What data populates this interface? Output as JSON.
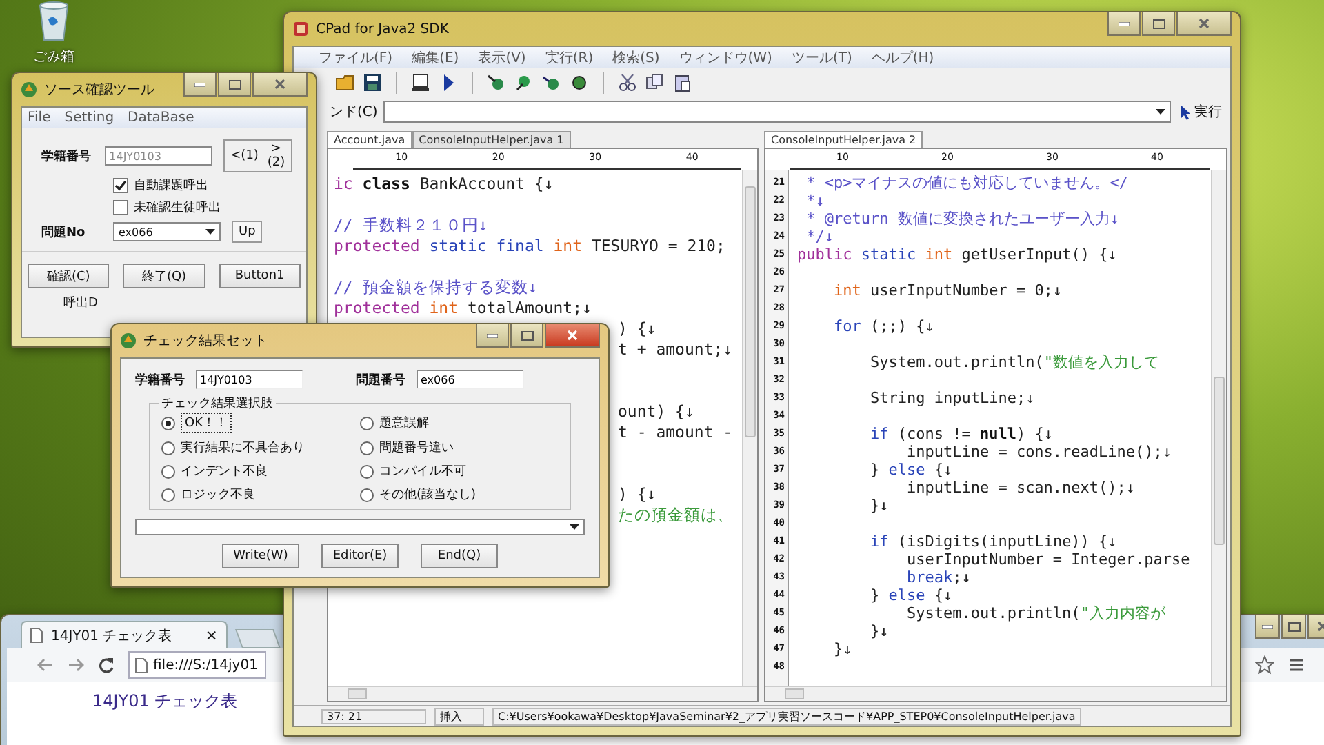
{
  "desktop": {
    "icons": [
      {
        "label": "ごみ箱"
      }
    ]
  },
  "source_tool": {
    "title": "ソース確認ツール",
    "menu": [
      "File",
      "Setting",
      "DataBase"
    ],
    "student_label": "学籍番号",
    "student_id": "14JY0103",
    "nav_buttons": [
      "<(1)",
      ">(2)"
    ],
    "checkboxes": [
      {
        "label": "自動課題呼出",
        "checked": true
      },
      {
        "label": "未確認生徒呼出",
        "checked": false
      }
    ],
    "problem_label": "問題No",
    "problem_value": "ex066",
    "up_button": "Up",
    "buttons": [
      "確認(C)",
      "終了(Q)",
      "Button1"
    ],
    "call_label": "呼出D"
  },
  "editor_window": {
    "title": "CPad for Java2 SDK",
    "menu": [
      "ファイル(F)",
      "編集(E)",
      "表示(V)",
      "実行(R)",
      "検索(S)",
      "ウィンドウ(W)",
      "ツール(T)",
      "ヘルプ(H)"
    ],
    "command_label": "ンド(C)",
    "run_button": "実行",
    "panes": [
      {
        "tabs": [
          {
            "label": "Account.java",
            "selected": true
          },
          {
            "label": "ConsoleInputHelper.java 1",
            "selected": false
          }
        ],
        "ruler": [
          "10",
          "20",
          "30",
          "40"
        ],
        "lines": [
          {
            "kind": "code",
            "tokens": [
              {
                "kind": "keyword",
                "text": "ic "
              },
              {
                "kind": "bold",
                "text": "class"
              },
              {
                "kind": "plain",
                "text": " BankAccount {↓"
              }
            ]
          },
          {
            "kind": "blank"
          },
          {
            "kind": "code",
            "tokens": [
              {
                "kind": "comment",
                "text": "// 手数料２１０円↓"
              }
            ]
          },
          {
            "kind": "code",
            "tokens": [
              {
                "kind": "keyword",
                "text": "protected"
              },
              {
                "kind": "modifier",
                "text": " static final"
              },
              {
                "kind": "type",
                "text": " int"
              },
              {
                "kind": "plain",
                "text": " TESURYO = 210;"
              }
            ]
          },
          {
            "kind": "blank"
          },
          {
            "kind": "code",
            "tokens": [
              {
                "kind": "comment",
                "text": "// 預金額を保持する変数↓"
              }
            ]
          },
          {
            "kind": "code",
            "tokens": [
              {
                "kind": "keyword",
                "text": "protected"
              },
              {
                "kind": "type",
                "text": " int"
              },
              {
                "kind": "plain",
                "text": " totalAmount;↓"
              }
            ]
          },
          {
            "kind": "tail",
            "tokens": [
              {
                "kind": "plain",
                "text": ") {↓"
              }
            ]
          },
          {
            "kind": "tail",
            "tokens": [
              {
                "kind": "plain",
                "text": "t + amount;↓"
              }
            ]
          },
          {
            "kind": "blank"
          },
          {
            "kind": "blank"
          },
          {
            "kind": "tail",
            "tokens": [
              {
                "kind": "plain",
                "text": "ount) {↓"
              }
            ]
          },
          {
            "kind": "tail",
            "tokens": [
              {
                "kind": "plain",
                "text": "t - amount -"
              }
            ]
          },
          {
            "kind": "blank"
          },
          {
            "kind": "blank"
          },
          {
            "kind": "tail",
            "tokens": [
              {
                "kind": "plain",
                "text": ") {↓"
              }
            ]
          },
          {
            "kind": "tail",
            "tokens": [
              {
                "kind": "string",
                "text": "たの預金額は、"
              }
            ]
          }
        ]
      },
      {
        "tabs": [
          {
            "label": "ConsoleInputHelper.java 2",
            "selected": true
          }
        ],
        "ruler": [
          "10",
          "20",
          "30",
          "40"
        ],
        "lines": [
          {
            "number": "21",
            "tokens": [
              {
                "kind": "comment",
                "text": " * <p>マイナスの値にも対応していません。</"
              }
            ]
          },
          {
            "number": "22",
            "tokens": [
              {
                "kind": "comment",
                "text": " *↓"
              }
            ]
          },
          {
            "number": "23",
            "tokens": [
              {
                "kind": "comment",
                "text": " * @return 数値に変換されたユーザー入力↓"
              }
            ]
          },
          {
            "number": "24",
            "tokens": [
              {
                "kind": "comment",
                "text": " */↓"
              }
            ]
          },
          {
            "number": "25",
            "tokens": [
              {
                "kind": "keyword",
                "text": "public"
              },
              {
                "kind": "modifier",
                "text": " static"
              },
              {
                "kind": "type",
                "text": " int"
              },
              {
                "kind": "plain",
                "text": " getUserInput() {↓"
              }
            ]
          },
          {
            "number": "26"
          },
          {
            "number": "27",
            "tokens": [
              {
                "kind": "type",
                "text": "    int"
              },
              {
                "kind": "plain",
                "text": " userInputNumber = 0;↓"
              }
            ]
          },
          {
            "number": "28"
          },
          {
            "number": "29",
            "tokens": [
              {
                "kind": "modifier",
                "text": "    for"
              },
              {
                "kind": "plain",
                "text": " (;;) {↓"
              }
            ]
          },
          {
            "number": "30"
          },
          {
            "number": "31",
            "tokens": [
              {
                "kind": "plain",
                "text": "        System.out.println("
              },
              {
                "kind": "string",
                "text": "\"数値を入力して"
              }
            ]
          },
          {
            "number": "32"
          },
          {
            "number": "33",
            "tokens": [
              {
                "kind": "plain",
                "text": "        String inputLine;↓"
              }
            ]
          },
          {
            "number": "34"
          },
          {
            "number": "35",
            "tokens": [
              {
                "kind": "modifier",
                "text": "        if"
              },
              {
                "kind": "plain",
                "text": " (cons != "
              },
              {
                "kind": "bold",
                "text": "null"
              },
              {
                "kind": "plain",
                "text": ") {↓"
              }
            ]
          },
          {
            "number": "36",
            "tokens": [
              {
                "kind": "plain",
                "text": "            inputLine = cons.readLine();↓"
              }
            ]
          },
          {
            "number": "37",
            "tokens": [
              {
                "kind": "plain",
                "text": "        } "
              },
              {
                "kind": "modifier",
                "text": "else"
              },
              {
                "kind": "plain",
                "text": " {↓"
              }
            ]
          },
          {
            "number": "38",
            "tokens": [
              {
                "kind": "plain",
                "text": "            inputLine = scan.next();↓"
              }
            ]
          },
          {
            "number": "39",
            "tokens": [
              {
                "kind": "plain",
                "text": "        }↓"
              }
            ]
          },
          {
            "number": "40"
          },
          {
            "number": "41",
            "tokens": [
              {
                "kind": "modifier",
                "text": "        if"
              },
              {
                "kind": "plain",
                "text": " (isDigits(inputLine)) {↓"
              }
            ]
          },
          {
            "number": "42",
            "tokens": [
              {
                "kind": "plain",
                "text": "            userInputNumber = Integer.parse"
              }
            ]
          },
          {
            "number": "43",
            "tokens": [
              {
                "kind": "modifier",
                "text": "            break"
              },
              {
                "kind": "plain",
                "text": ";↓"
              }
            ]
          },
          {
            "number": "44",
            "tokens": [
              {
                "kind": "plain",
                "text": "        } "
              },
              {
                "kind": "modifier",
                "text": "else"
              },
              {
                "kind": "plain",
                "text": " {↓"
              }
            ]
          },
          {
            "number": "45",
            "tokens": [
              {
                "kind": "plain",
                "text": "            System.out.println("
              },
              {
                "kind": "string",
                "text": "\"入力内容が"
              }
            ]
          },
          {
            "number": "46",
            "tokens": [
              {
                "kind": "plain",
                "text": "        }↓"
              }
            ]
          },
          {
            "number": "47",
            "tokens": [
              {
                "kind": "plain",
                "text": "    }↓"
              }
            ]
          },
          {
            "number": "48"
          }
        ]
      }
    ],
    "status_bar": {
      "position": "37: 21",
      "mode": "挿入",
      "path": "C:¥Users¥ookawa¥Desktop¥JavaSeminar¥2_アプリ実習ソースコード¥APP_STEP0¥ConsoleInputHelper.java"
    }
  },
  "dialog": {
    "title": "チェック結果セット",
    "student_label": "学籍番号",
    "student_id": "14JY0103",
    "problem_label": "問題番号",
    "problem_value": "ex066",
    "group_label": "チェック結果選択肢",
    "options": [
      {
        "label": "OK！！",
        "selected": true
      },
      {
        "label": "題意誤解",
        "selected": false
      },
      {
        "label": "実行結果に不具合あり",
        "selected": false
      },
      {
        "label": "問題番号違い",
        "selected": false
      },
      {
        "label": "インデント不良",
        "selected": false
      },
      {
        "label": "コンパイル不可",
        "selected": false
      },
      {
        "label": "ロジック不良",
        "selected": false
      },
      {
        "label": "その他(該当なし)",
        "selected": false
      }
    ],
    "buttons": [
      "Write(W)",
      "Editor(E)",
      "End(Q)"
    ]
  },
  "browser": {
    "tab": {
      "title": "14JY01 チェック表",
      "close": "×"
    },
    "address": "file:///S:/14jy01",
    "heading": "14JY01 チェック表"
  }
}
